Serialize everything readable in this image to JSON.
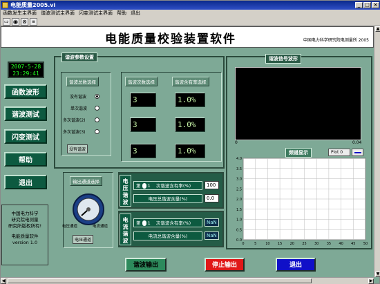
{
  "window": {
    "title": "电能质量2005.vi"
  },
  "menu": [
    "函数发生主界面",
    "谐波测试主界面",
    "闪变测试主界面",
    "帮助",
    "退出"
  ],
  "toolbar": [
    "⇨",
    "◉",
    "⊗",
    "⏸"
  ],
  "header": {
    "title": "电能质量校验装置软件",
    "org": "中国电力科学研究院电测量所 2005"
  },
  "clock": {
    "date": "2007-5-28",
    "time": "23:29:41"
  },
  "nav": [
    {
      "label": "函数波形"
    },
    {
      "label": "谐波测试"
    },
    {
      "label": "闪变测试"
    },
    {
      "label": "帮助"
    },
    {
      "label": "退出"
    }
  ],
  "copyright": [
    "中国电力科学",
    "研究院电测量",
    "研究所版权所有!",
    "",
    "电能质量软件",
    "version 1.0"
  ],
  "harm": {
    "panel_title": "谐波参数设置",
    "select_title": "谐波总数选择",
    "options": [
      "没有谐波",
      "单次谐波",
      "多次谐波(2)",
      "多次谐波(3)"
    ],
    "selected": 0,
    "indicator": "没有谐波",
    "order_title": "谐波次数选择",
    "rate_title": "谐波含有率选择",
    "orders": [
      "3",
      "3",
      "3"
    ],
    "rates": [
      "1.0%",
      "1.0%",
      "1.0%"
    ]
  },
  "channel": {
    "title": "输出通道选择",
    "left": "电压通道",
    "right": "电流通道",
    "indicator": "电压通道"
  },
  "voltage": {
    "label": "电压谐波",
    "prefix": "第",
    "order": "1",
    "rate_label": "次谐波含有率(%)",
    "rate_value": "100",
    "total_label": "电压总谐波含量(%)",
    "total_value": "0.0"
  },
  "current": {
    "label": "电流谐波",
    "prefix": "第",
    "order": "1",
    "rate_label": "次谐波含有率(%)",
    "rate_value": "NaN",
    "total_label": "电流总谐波含量(%)",
    "total_value": "NaN"
  },
  "wave": {
    "title": "谐波信号波形",
    "x_min": "0",
    "x_max": "0.04"
  },
  "spectrum": {
    "title": "频谱显示",
    "legend": "Plot 0"
  },
  "buttons": {
    "harm_out": "谐波输出",
    "stop_out": "停止输出",
    "exit": "退出"
  },
  "colors": {
    "stop_bg": "#e01818",
    "exit_bg": "#1010c8",
    "harm_bg": "#2d8a5c"
  },
  "chart_data": [
    {
      "type": "line",
      "title": "谐波信号波形",
      "xlim": [
        0,
        0.04
      ],
      "x_ticks": [
        "0",
        "0.04"
      ],
      "series": []
    },
    {
      "type": "bar",
      "title": "频谱显示",
      "legend": [
        "Plot 0"
      ],
      "xlim": [
        0,
        50
      ],
      "ylim": [
        0,
        4
      ],
      "x_ticks": [
        "0",
        "5",
        "10",
        "15",
        "20",
        "25",
        "30",
        "35",
        "40",
        "45",
        "50"
      ],
      "y_ticks": [
        "0.0",
        "0.5",
        "1.0",
        "1.5",
        "2.0",
        "2.5",
        "3.0",
        "3.5",
        "4.0"
      ],
      "grid": true,
      "series": []
    }
  ]
}
